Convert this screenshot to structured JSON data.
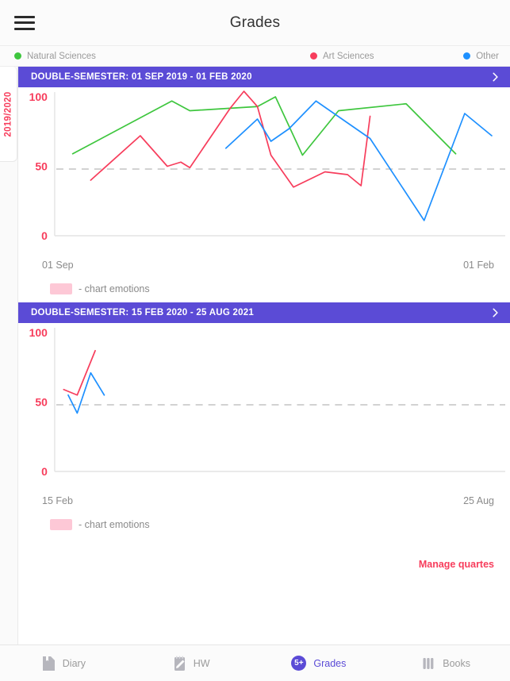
{
  "header": {
    "title": "Grades",
    "menu_icon": "hamburger-menu-icon"
  },
  "legend": [
    {
      "label": "Natural Sciences",
      "color": "#3ec63e",
      "icon": "legend-dot-icon"
    },
    {
      "label": "Art Sciences",
      "color": "#f73d5c",
      "icon": "legend-dot-icon"
    },
    {
      "label": "Other",
      "color": "#1e90ff",
      "icon": "legend-dot-icon"
    }
  ],
  "year_tab": {
    "label": "2019/2020"
  },
  "sections": [
    {
      "bar_label": "DOUBLE-SEMESTER: 01 SEP 2019 - 01 FEB 2020",
      "chevron_icon": "chevron-right-icon",
      "x_start": "01 Sep",
      "x_end": "01 Feb",
      "emotions_label": "- chart emotions",
      "emotions_color": "#fdc8d6"
    },
    {
      "bar_label": "DOUBLE-SEMESTER: 15 FEB 2020 - 25 AUG 2021",
      "chevron_icon": "chevron-right-icon",
      "x_start": "15 Feb",
      "x_end": "25 Aug",
      "emotions_label": "- chart emotions",
      "emotions_color": "#fdc8d6"
    }
  ],
  "manage_link": {
    "label": "Manage quartes",
    "color": "#f73d5c"
  },
  "bottom_nav": [
    {
      "label": "Diary",
      "icon": "book-page-icon",
      "active": false
    },
    {
      "label": "HW",
      "icon": "notepad-pen-icon",
      "active": false
    },
    {
      "label": "Grades",
      "icon": "grade-5plus-badge-icon",
      "badge": "5+",
      "active": true
    },
    {
      "label": "Books",
      "icon": "books-spines-icon",
      "active": false
    }
  ],
  "chart_data": [
    {
      "type": "line",
      "title": "DOUBLE-SEMESTER: 01 SEP 2019 - 01 FEB 2020",
      "xlabel": "",
      "ylabel": "",
      "ylim": [
        0,
        100
      ],
      "yticks": [
        0,
        50,
        100
      ],
      "xticks": [
        "01 Sep",
        "01 Feb"
      ],
      "grid": false,
      "reference_line": 48,
      "legend_position": "top",
      "series": [
        {
          "name": "Natural Sciences",
          "color": "#3ec63e",
          "points": [
            {
              "x": 4,
              "y": 59
            },
            {
              "x": 26,
              "y": 97
            },
            {
              "x": 30,
              "y": 90
            },
            {
              "x": 45,
              "y": 93
            },
            {
              "x": 49,
              "y": 100
            },
            {
              "x": 55,
              "y": 58
            },
            {
              "x": 63,
              "y": 90
            },
            {
              "x": 78,
              "y": 95
            },
            {
              "x": 89,
              "y": 59
            }
          ]
        },
        {
          "name": "Art Sciences",
          "color": "#f73d5c",
          "points": [
            {
              "x": 8,
              "y": 40
            },
            {
              "x": 19,
              "y": 72
            },
            {
              "x": 25,
              "y": 50
            },
            {
              "x": 28,
              "y": 53
            },
            {
              "x": 30,
              "y": 49
            },
            {
              "x": 39,
              "y": 92
            },
            {
              "x": 42,
              "y": 104
            },
            {
              "x": 45,
              "y": 93
            },
            {
              "x": 48,
              "y": 58
            },
            {
              "x": 53,
              "y": 35
            },
            {
              "x": 60,
              "y": 46
            },
            {
              "x": 65,
              "y": 44
            },
            {
              "x": 68,
              "y": 36
            },
            {
              "x": 70,
              "y": 86
            }
          ]
        },
        {
          "name": "Other",
          "color": "#1e90ff",
          "points": [
            {
              "x": 38,
              "y": 63
            },
            {
              "x": 45,
              "y": 84
            },
            {
              "x": 48,
              "y": 68
            },
            {
              "x": 52,
              "y": 77
            },
            {
              "x": 58,
              "y": 97
            },
            {
              "x": 70,
              "y": 70
            },
            {
              "x": 82,
              "y": 11
            },
            {
              "x": 91,
              "y": 88
            },
            {
              "x": 97,
              "y": 72
            }
          ]
        }
      ]
    },
    {
      "type": "line",
      "title": "DOUBLE-SEMESTER: 15 FEB 2020 - 25 AUG 2021",
      "xlabel": "",
      "ylabel": "",
      "ylim": [
        0,
        100
      ],
      "yticks": [
        0,
        50,
        100
      ],
      "xticks": [
        "15 Feb",
        "25 Aug"
      ],
      "grid": false,
      "reference_line": 48,
      "legend_position": "top",
      "series": [
        {
          "name": "Art Sciences",
          "color": "#f73d5c",
          "points": [
            {
              "x": 2,
              "y": 59
            },
            {
              "x": 5,
              "y": 55
            },
            {
              "x": 9,
              "y": 87
            }
          ]
        },
        {
          "name": "Other",
          "color": "#1e90ff",
          "points": [
            {
              "x": 3,
              "y": 55
            },
            {
              "x": 5,
              "y": 42
            },
            {
              "x": 8,
              "y": 71
            },
            {
              "x": 11,
              "y": 55
            }
          ]
        }
      ]
    }
  ]
}
